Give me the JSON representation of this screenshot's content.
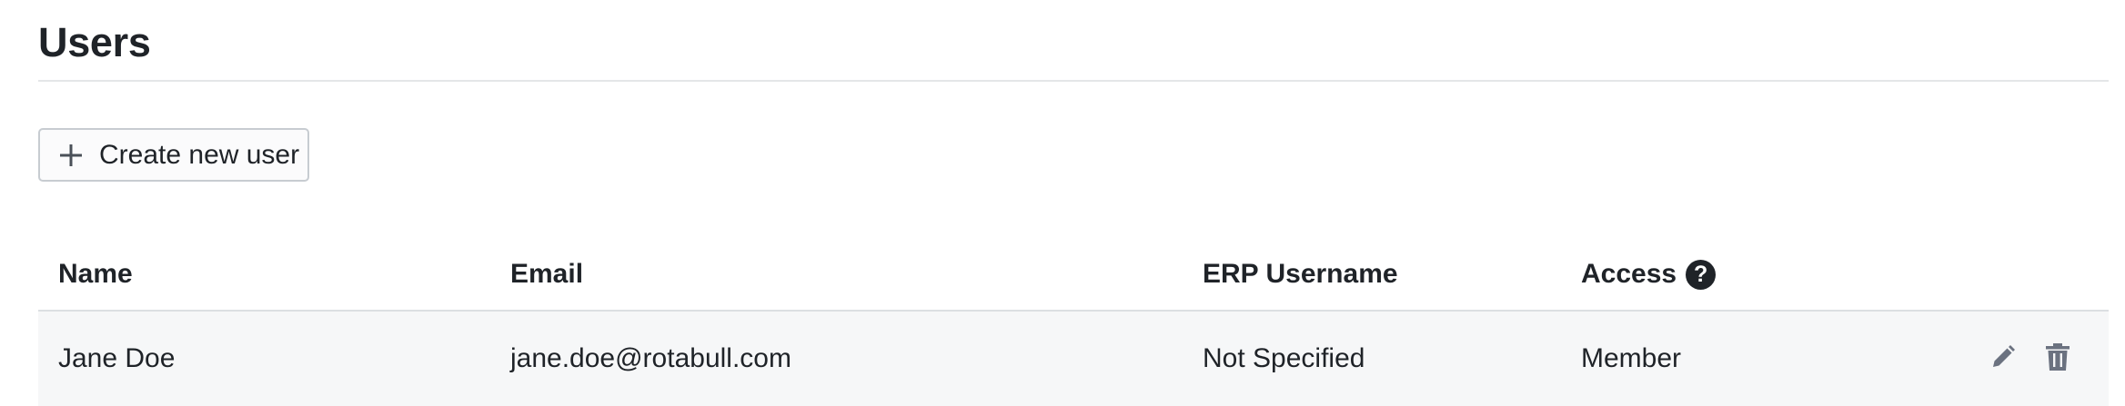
{
  "page": {
    "title": "Users"
  },
  "toolbar": {
    "create_label": "Create new user",
    "create_icon": "plus-icon"
  },
  "table": {
    "columns": [
      {
        "key": "name",
        "label": "Name"
      },
      {
        "key": "email",
        "label": "Email"
      },
      {
        "key": "erp_username",
        "label": "ERP Username"
      },
      {
        "key": "access",
        "label": "Access",
        "icon": "question-circle-icon",
        "icon_glyph": "?"
      }
    ],
    "rows": [
      {
        "name": "Jane Doe",
        "email": "jane.doe@rotabull.com",
        "erp_username": "Not Specified",
        "access": "Member",
        "actions": [
          "pencil-icon",
          "trash-icon"
        ]
      }
    ]
  },
  "colors": {
    "text": "#1f2328",
    "row_background": "#f6f7f8",
    "action_icon": "#6b7280",
    "border": "#c7ccd1"
  }
}
